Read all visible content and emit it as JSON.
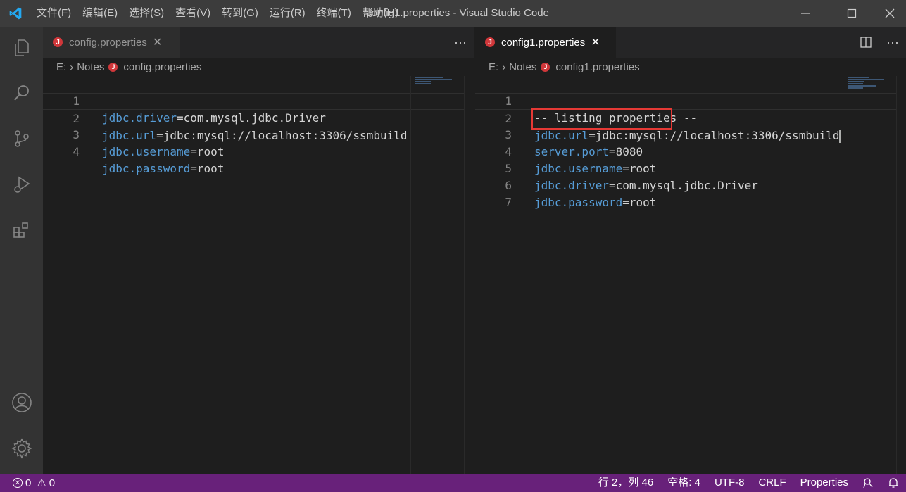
{
  "window": {
    "title": "config1.properties - Visual Studio Code"
  },
  "menu": [
    "文件(F)",
    "编辑(E)",
    "选择(S)",
    "查看(V)",
    "转到(G)",
    "运行(R)",
    "终端(T)",
    "帮助(H)"
  ],
  "activity_bar": {
    "icons": [
      "explorer-icon",
      "search-icon",
      "source-control-icon",
      "run-debug-icon",
      "extensions-icon",
      "account-icon",
      "settings-gear-icon"
    ]
  },
  "left_group": {
    "tab": {
      "label": "config.properties",
      "icon_letter": "J"
    },
    "breadcrumb": {
      "drive": "E:",
      "folder": "Notes",
      "file": "config.properties"
    },
    "lines": [
      {
        "num": "1",
        "key": "jdbc.driver",
        "eq": "=",
        "val": "com.mysql.jdbc.Driver"
      },
      {
        "num": "2",
        "key": "jdbc.url",
        "eq": "=",
        "val": "jdbc:mysql://localhost:3306/ssmbuild"
      },
      {
        "num": "3",
        "key": "jdbc.username",
        "eq": "=",
        "val": "root"
      },
      {
        "num": "4",
        "key": "jdbc.password",
        "eq": "=",
        "val": "root"
      }
    ]
  },
  "right_group": {
    "tab": {
      "label": "config1.properties",
      "icon_letter": "J"
    },
    "breadcrumb": {
      "drive": "E:",
      "folder": "Notes",
      "file": "config1.properties"
    },
    "lines": [
      {
        "num": "1",
        "key": "",
        "eq": "",
        "val": "-- listing properties --"
      },
      {
        "num": "2",
        "key": "jdbc.url",
        "eq": "=",
        "val": "jdbc:mysql://localhost:3306/ssmbuild"
      },
      {
        "num": "3",
        "key": "server.port",
        "eq": "=",
        "val": "8080"
      },
      {
        "num": "4",
        "key": "jdbc.username",
        "eq": "=",
        "val": "root"
      },
      {
        "num": "5",
        "key": "jdbc.driver",
        "eq": "=",
        "val": "com.mysql.jdbc.Driver"
      },
      {
        "num": "6",
        "key": "jdbc.password",
        "eq": "=",
        "val": "root"
      },
      {
        "num": "7",
        "key": "",
        "eq": "",
        "val": ""
      }
    ]
  },
  "statusbar": {
    "errors": "0",
    "warnings": "0",
    "position": "行 2，列 46",
    "spaces": "空格: 4",
    "encoding": "UTF-8",
    "eol": "CRLF",
    "language": "Properties"
  },
  "colors": {
    "statusbar": "#68217a",
    "highlight": "#e53935",
    "key": "#569cd6"
  }
}
